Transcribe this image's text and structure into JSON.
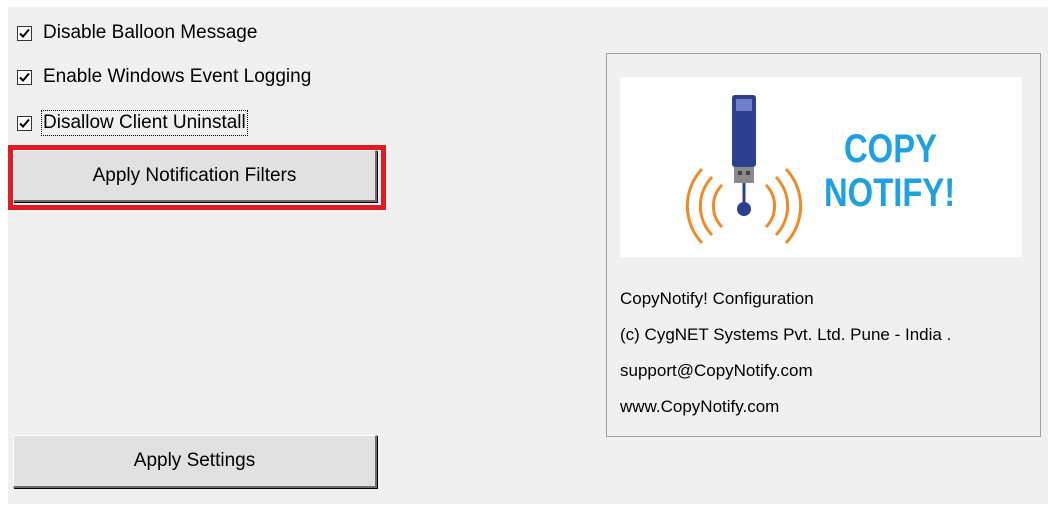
{
  "checkboxes": [
    {
      "label": "Disable Balloon Message",
      "checked": true
    },
    {
      "label": "Enable Windows Event Logging",
      "checked": true
    },
    {
      "label": "Disallow Client Uninstall",
      "checked": true
    }
  ],
  "buttons": {
    "apply_filters": "Apply Notification Filters",
    "apply_settings": "Apply Settings"
  },
  "logo": {
    "line1": "COPY",
    "line2": "NOTIFY!",
    "text_color": "#1fa0e3",
    "signal_color": "#f08a24",
    "usb_color": "#2f3f8f"
  },
  "about": {
    "line1": "CopyNotify! Configuration",
    "line2": "(c) CygNET Systems Pvt. Ltd. Pune - India .",
    "line3": "support@CopyNotify.com",
    "line4": "www.CopyNotify.com"
  },
  "highlight_color": "#e11b24"
}
